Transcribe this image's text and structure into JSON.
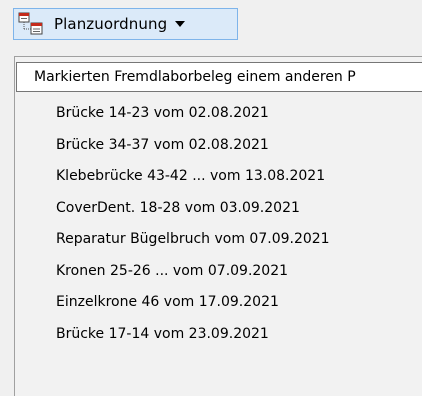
{
  "toolbar": {
    "plan_button_label": "Planzuordnung"
  },
  "menu": {
    "header": "Markierten Fremdlaborbeleg einem anderen P",
    "items": [
      "Brücke 14-23 vom 02.08.2021",
      "Brücke 34-37 vom 02.08.2021",
      "Klebebrücke 43-42 ... vom 13.08.2021",
      "CoverDent. 18-28 vom 03.09.2021",
      "Reparatur Bügelbruch vom 07.09.2021",
      "Kronen 25-26 ... vom 07.09.2021",
      "Einzelkrone  46 vom 17.09.2021",
      "Brücke 17-14 vom 23.09.2021"
    ]
  },
  "colors": {
    "button_bg": "#dbeaf9",
    "button_border": "#7eb4ea",
    "icon_red": "#c42b1c"
  },
  "icons": {
    "plan_button": "document-assignment-icon",
    "dropdown": "chevron-down-icon"
  }
}
